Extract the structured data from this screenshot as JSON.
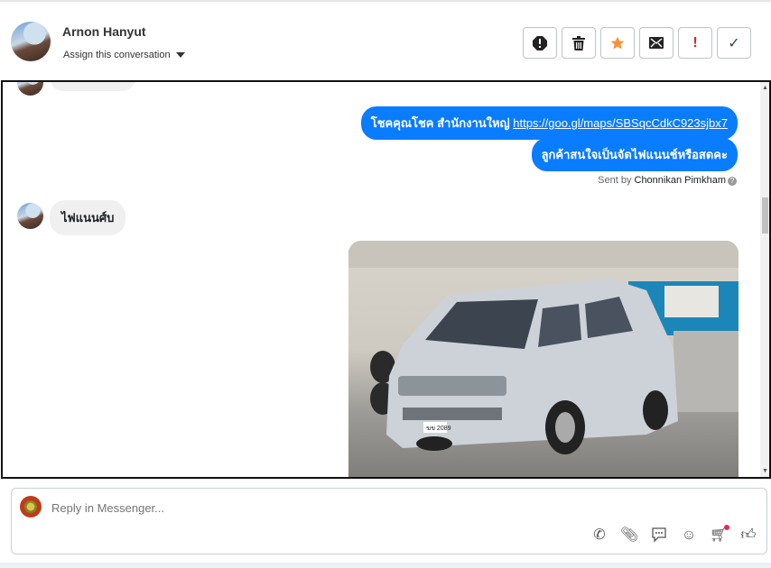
{
  "header": {
    "name": "Arnon Hanyut",
    "assign_label": "Assign this conversation"
  },
  "actions": [
    {
      "name": "report-spam",
      "icon": "alert-octagon-icon"
    },
    {
      "name": "delete",
      "icon": "trash-icon"
    },
    {
      "name": "star",
      "icon": "star-icon"
    },
    {
      "name": "mark-unread",
      "icon": "envelope-icon"
    },
    {
      "name": "important",
      "icon": "exclamation-icon"
    },
    {
      "name": "done",
      "icon": "check-icon"
    }
  ],
  "messages": {
    "out1_text": "โชคคุณโชค สำนักงานใหญ่ ",
    "out1_link": "https://goo.gl/maps/SBSqcCdkC923sjbx7",
    "out2_text": "ลูกค้าสนใจเป็นจัดไฟแนนช์หรือสดคะ",
    "sent_by_prefix": "Sent by ",
    "sent_by_name": "Chonnikan Pimkham",
    "in1_text": "ไฟแนนศ์บ",
    "plate": "ฆข 2089"
  },
  "composer": {
    "placeholder": "Reply in Messenger..."
  },
  "colors": {
    "accent": "#0a7cff",
    "star": "#f7923a",
    "important": "#e02020"
  }
}
